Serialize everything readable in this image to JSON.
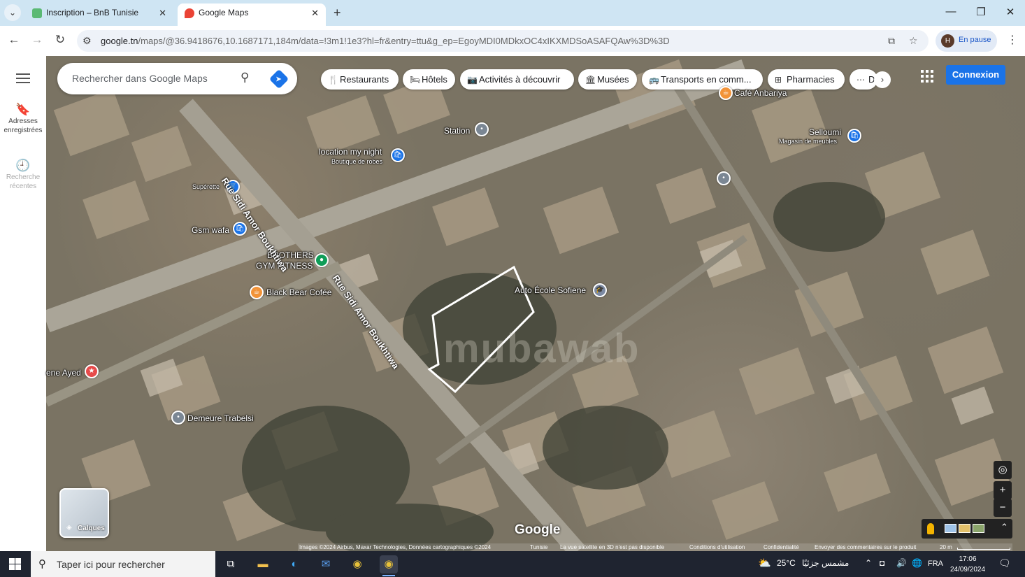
{
  "browser": {
    "tabs": [
      {
        "title": "Inscription – BnB Tunisie",
        "favicon_color": "#5bb974",
        "active": false
      },
      {
        "title": "Google Maps",
        "favicon_color": "#ea4335",
        "active": true
      }
    ],
    "new_tab_symbol": "+",
    "url_host": "google.tn",
    "url_path": "/maps/@36.9418676,10.1687171,184m/data=!3m1!1e3?hl=fr&entry=ttu&g_ep=EgoyMDI0MDkxOC4xIKXMDSoASAFQAw%3D%3D",
    "profile_initial": "H",
    "profile_status": "En pause"
  },
  "rail": {
    "saved_label": "Adresses enregistrées",
    "recent_label": "Recherche récentes"
  },
  "map": {
    "search_placeholder": "Rechercher dans Google Maps",
    "chips": [
      {
        "label": "Restaurants",
        "icon": "fork-knife-icon"
      },
      {
        "label": "Hôtels",
        "icon": "bed-icon"
      },
      {
        "label": "Activités à découvrir",
        "icon": "camera-icon"
      },
      {
        "label": "Musées",
        "icon": "museum-icon"
      },
      {
        "label": "Transports en comm...",
        "icon": "bus-icon"
      },
      {
        "label": "Pharmacies",
        "icon": "pharmacy-icon"
      },
      {
        "label": "D",
        "icon": "more-icon"
      }
    ],
    "login_label": "Connexion",
    "places": {
      "cafe_anbariya": "Café Anbariya",
      "station": "Station",
      "location_my_night": "location my night",
      "location_my_night_sub": "Boutique de robes",
      "selloumi": "Selloumi",
      "selloumi_sub": "Magasin de meubles",
      "superette": "Supérette",
      "gsm_wafa": "Gsm wafa",
      "brothers_line1": "BROTHERS",
      "brothers_line2": "GYM FITNESS",
      "black_bear": "Black Bear Cofée",
      "auto_ecole": "Auto École Sofiene",
      "ene_ayed": "ene Ayed",
      "demeure": "Demeure Trabelsi"
    },
    "streets": {
      "north": "Rue Sidi Amor Boukhtiwa",
      "south": "Rue Sidi Amor Boukhtiwa"
    },
    "watermark": "mubawab",
    "layers_label": "Calques",
    "google_logo": "Google",
    "attribution": {
      "images": "Images ©2024 Airbus, Maxar Technologies, Données cartographiques ©2024",
      "country": "Tunisie",
      "satellite_note": "La vue satellite en 3D n'est pas disponible",
      "terms": "Conditions d'utilisation",
      "privacy": "Confidentialité",
      "feedback": "Envoyer des commentaires sur le produit",
      "scale": "20 m"
    }
  },
  "taskbar": {
    "search_placeholder": "Taper ici pour rechercher",
    "weather_temp": "25°C",
    "weather_desc": "مشمس جزئيًا",
    "language": "FRA",
    "time": "17:06",
    "date": "24/09/2024"
  }
}
